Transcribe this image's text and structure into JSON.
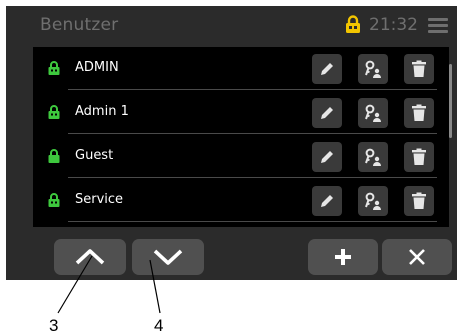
{
  "header": {
    "title": "Benutzer",
    "time": "21:32",
    "lock_icon": "lock-icon",
    "lock_color": "#f2c500",
    "menu_icon": "hamburger-menu-icon"
  },
  "users": [
    {
      "name": "ADMIN",
      "lock_color": "#3ec83e"
    },
    {
      "name": "Admin 1",
      "lock_color": "#3ec83e"
    },
    {
      "name": "Guest",
      "lock_color": "#3ec83e"
    },
    {
      "name": "Service",
      "lock_color": "#3ec83e"
    }
  ],
  "row_actions": {
    "edit_icon": "pencil-icon",
    "permissions_icon": "key-user-icon",
    "delete_icon": "trash-icon"
  },
  "bottom_bar": {
    "up_icon": "chevron-up-icon",
    "down_icon": "chevron-down-icon",
    "add_icon": "plus-icon",
    "close_icon": "close-icon"
  },
  "callouts": {
    "up": "3",
    "down": "4"
  },
  "colors": {
    "background": "#2b2b2b",
    "list_background": "#000000",
    "header_text": "#6f6f6f",
    "button": "#505050"
  }
}
